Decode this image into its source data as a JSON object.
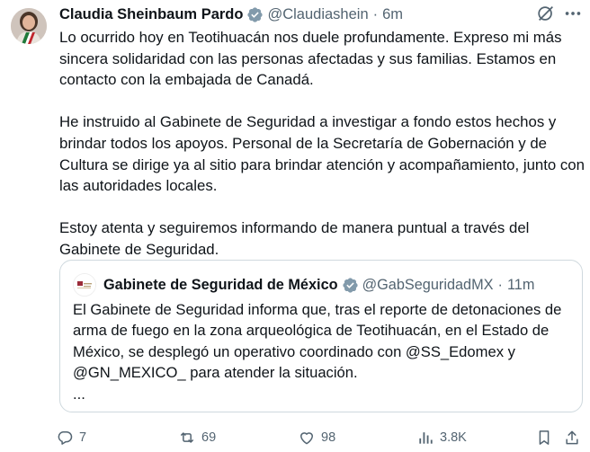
{
  "tweet": {
    "author_name": "Claudia Sheinbaum Pardo",
    "handle": "@Claudiashein",
    "separator": "·",
    "time": "6m",
    "paragraphs": [
      "Lo ocurrido hoy en Teotihuacán nos duele profundamente. Expreso mi más sincera solidaridad con las personas afectadas y sus familias. Estamos en contacto con la embajada de Canadá.",
      "He instruido al Gabinete de Seguridad a investigar a fondo estos hechos y brindar todos los apoyos. Personal de la Secretaría de Gobernación y de Cultura se dirige ya al sitio para brindar atención y acompañamiento, junto con las autoridades locales.",
      "Estoy atenta y seguiremos informando de manera puntual a través del Gabinete de Seguridad."
    ]
  },
  "quoted": {
    "author_name": "Gabinete de Seguridad de México",
    "handle": "@GabSeguridadMX",
    "separator": "·",
    "time": "11m",
    "text": "El Gabinete de Seguridad informa que, tras el reporte de detonaciones de arma de fuego en la zona arqueológica de Teotihuacán, en el Estado de México, se desplegó un operativo coordinado con @SS_Edomex y @GN_MEXICO_ para atender la situación.",
    "ellipsis": "..."
  },
  "actions": {
    "replies": "7",
    "reposts": "69",
    "likes": "98",
    "views": "3.8K"
  },
  "icons": [
    "grok-icon",
    "more-icon",
    "verified-badge-icon",
    "reply-icon",
    "repost-icon",
    "like-icon",
    "views-icon",
    "bookmark-icon",
    "share-icon"
  ],
  "colors": {
    "text": "#0f1419",
    "muted": "#536471",
    "verified": "#829aab",
    "border": "#cfd9de"
  }
}
